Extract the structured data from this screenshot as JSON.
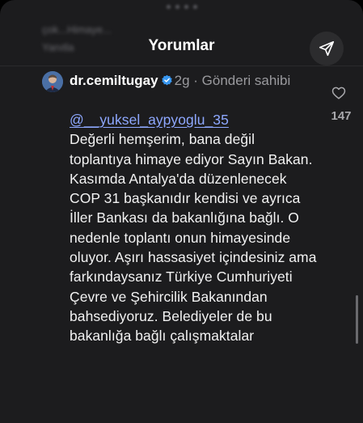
{
  "background_text": {
    "line1": "çok...Himaye...",
    "line2": "Yanıtla"
  },
  "header": {
    "title": "Yorumlar",
    "share_icon": "send-icon"
  },
  "comment": {
    "username": "dr.cemiltugay",
    "verified_icon": "verified-badge-icon",
    "time": "2g",
    "separator": "·",
    "author_tag": "Gönderi sahibi",
    "mention": "@__yuksel_aypyoglu_35",
    "text": "Değerli hemşerim, bana değil toplantıya himaye ediyor Sayın Bakan. Kasımda Antalya'da düzenlenecek COP 31 başkanıdır kendisi ve ayrıca İller Bankası da bakanlığına bağlı. O nedenle toplantı onun himayesinde oluyor. Aşırı hassasiyet içindesiniz ama farkındaysanız Türkiye Cumhuriyeti Çevre ve Şehircilik Bakanından bahsediyoruz. Belediyeler de bu bakanlığa bağlı çalışmaktalar",
    "like_icon": "heart-icon",
    "like_count": "147"
  },
  "colors": {
    "sheet_background": "#1c1c1e",
    "mention": "#8ea8ff",
    "verified": "#3897f0"
  }
}
